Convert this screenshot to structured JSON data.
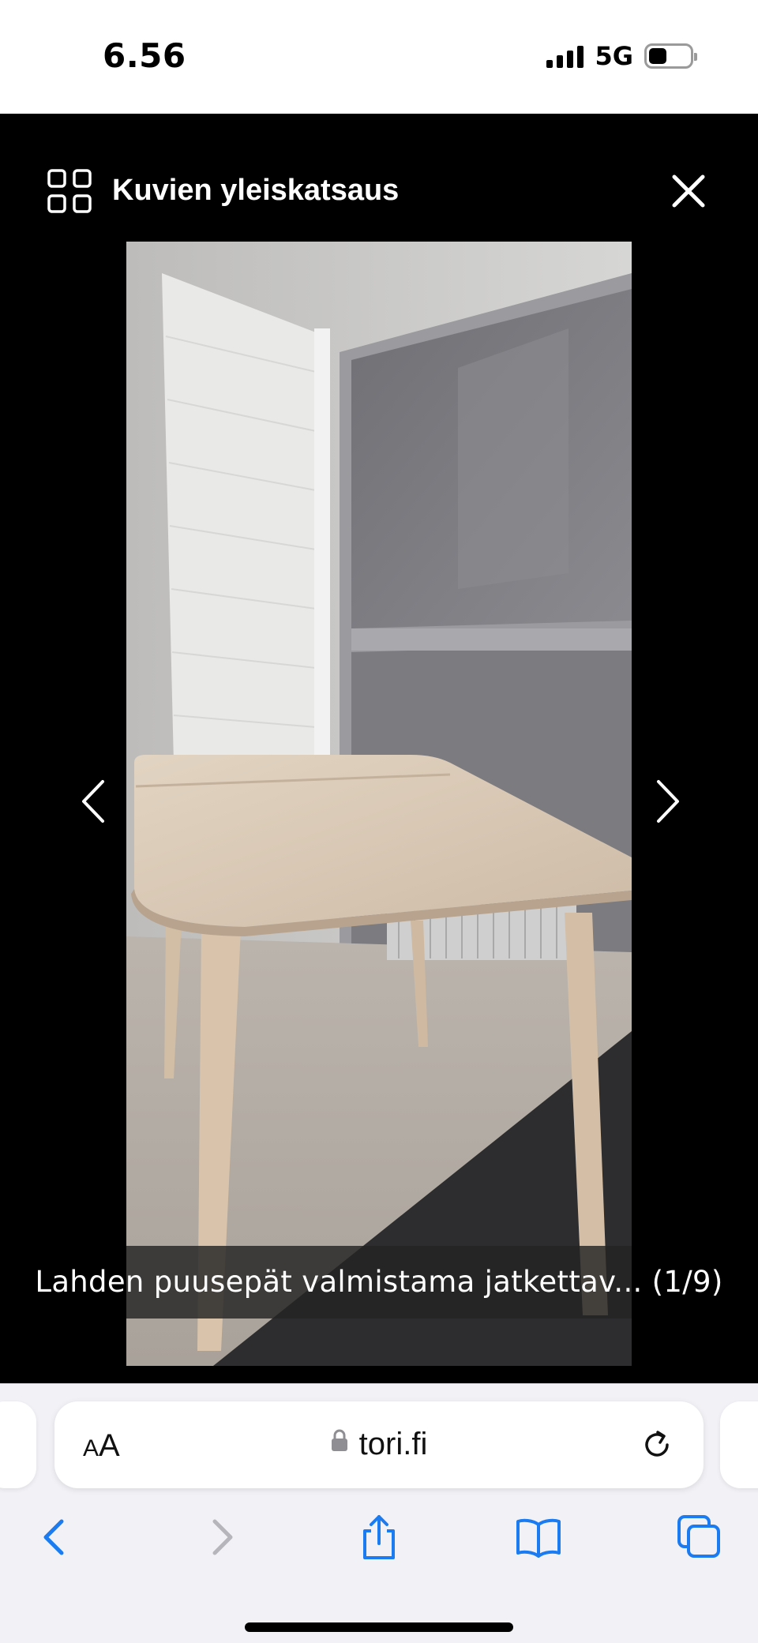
{
  "status": {
    "time": "6.56",
    "network": "5G",
    "icons": [
      "signal-icon",
      "battery-icon"
    ]
  },
  "viewer": {
    "title": "Kuvien yleiskatsaus",
    "caption": "Lahden puusepät valmistama jatkettav... (1/9)",
    "icons": [
      "grid-overview-icon",
      "close-icon",
      "chevron-left-icon",
      "chevron-right-icon"
    ]
  },
  "safari": {
    "aa_small": "A",
    "aa_large": "A",
    "url": "tori.fi",
    "icons": [
      "lock-icon",
      "reload-icon",
      "back-icon",
      "forward-icon",
      "share-icon",
      "bookmarks-icon",
      "tabs-icon"
    ]
  },
  "colors": {
    "accent": "#1a7cf0",
    "disabled": "#b5b5bb",
    "viewer_bg": "#000000",
    "toolbar_bg": "#f2f2f6"
  }
}
